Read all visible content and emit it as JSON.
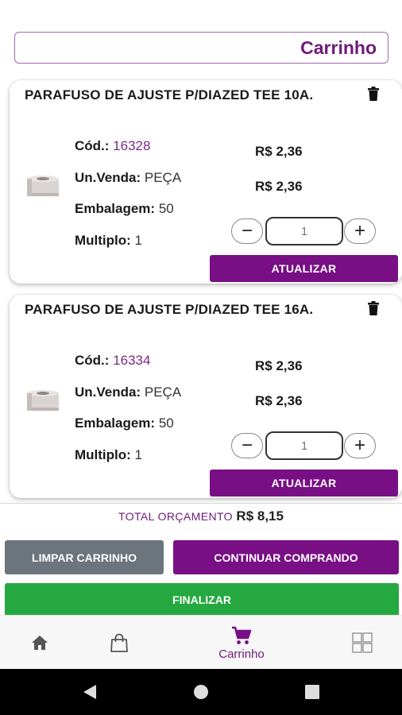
{
  "header": {
    "title": "Carrinho"
  },
  "labels": {
    "code": "Cód.:",
    "unit": "Un.Venda:",
    "package": "Embalagem:",
    "multiple": "Multiplo:",
    "update": "ATUALIZAR"
  },
  "items": [
    {
      "name": "PARAFUSO DE AJUSTE P/DIAZED TEE 10A.",
      "code": "16328",
      "unit": "PEÇA",
      "package": "50",
      "multiple": "1",
      "price_unit": "R$ 2,36",
      "price_total": "R$ 2,36",
      "quantity": "1"
    },
    {
      "name": "PARAFUSO DE AJUSTE P/DIAZED TEE 16A.",
      "code": "16334",
      "unit": "PEÇA",
      "package": "50",
      "multiple": "1",
      "price_unit": "R$ 2,36",
      "price_total": "R$ 2,36",
      "quantity": "1"
    }
  ],
  "total": {
    "label": "TOTAL ORÇAMENTO",
    "value": "R$ 8,15"
  },
  "actions": {
    "clear": "LIMPAR CARRINHO",
    "continue": "CONTINUAR COMPRANDO",
    "finish": "FINALIZAR"
  },
  "bottom_nav": {
    "items": [
      {
        "icon": "home-icon",
        "label": ""
      },
      {
        "icon": "shopping-bag-icon",
        "label": ""
      },
      {
        "icon": "cart-icon",
        "label": "Carrinho",
        "active": true
      },
      {
        "icon": "grid-icon",
        "label": ""
      }
    ]
  },
  "colors": {
    "brand_purple": "#780f84",
    "clear_gray": "#6c757d",
    "finish_green": "#26a841"
  }
}
